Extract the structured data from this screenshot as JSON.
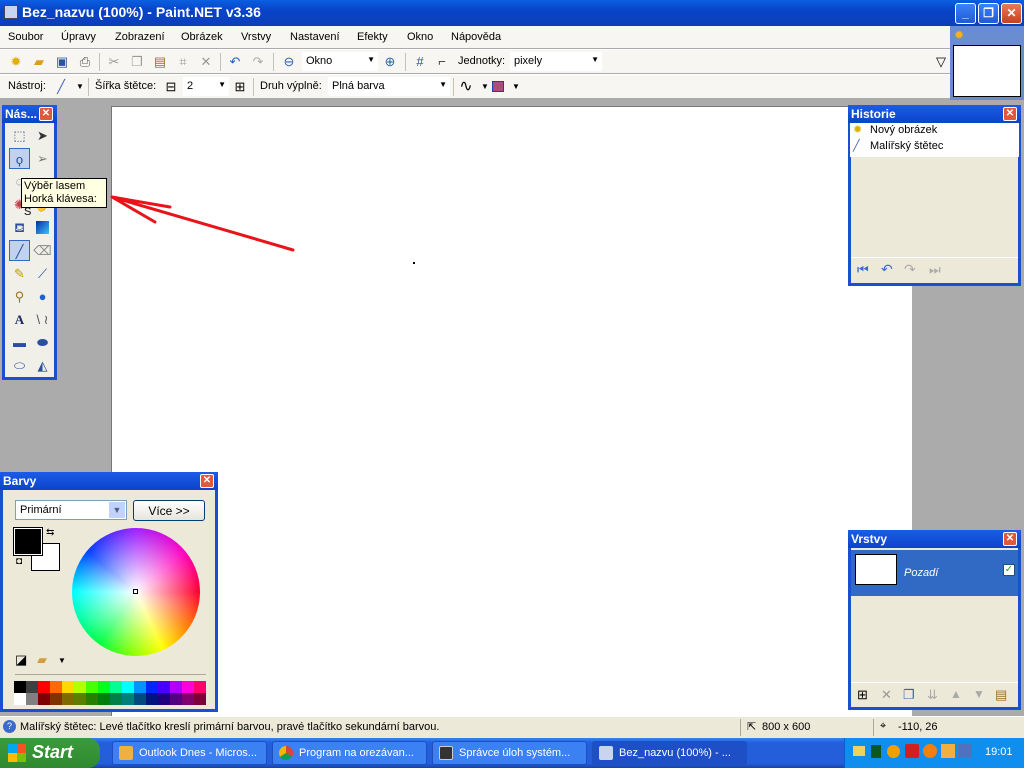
{
  "window": {
    "title": "Bez_nazvu (100%) - Paint.NET v3.36",
    "minimize": "_",
    "restore": "❐",
    "close": "✕"
  },
  "menu": [
    "Soubor",
    "Úpravy",
    "Zobrazení",
    "Obrázek",
    "Vrstvy",
    "Nastavení",
    "Efekty",
    "Okno",
    "Nápověda"
  ],
  "toolbar": {
    "zoom_value": "Okno",
    "units_label": "Jednotky:",
    "units_value": "pixely"
  },
  "toolbar2": {
    "tool_label": "Nástroj:",
    "brush_width_label": "Šířka štětce:",
    "brush_width_value": "2",
    "minus": "⊟",
    "plus": "⊞",
    "fill_label": "Druh výplně:",
    "fill_value": "Plná barva"
  },
  "tools_panel": {
    "title": "Nás...",
    "tooltip_line1": "Výběr lasem",
    "tooltip_line2": "Horká klávesa: S"
  },
  "history": {
    "title": "Historie",
    "items": [
      {
        "label": "Nový obrázek"
      },
      {
        "label": "Malířský štětec"
      }
    ]
  },
  "colors": {
    "title": "Barvy",
    "mode": "Primární",
    "more_button": "Více >>",
    "primary": "#000000",
    "secondary": "#ffffff",
    "palette_top": [
      "#000000",
      "#404040",
      "#ff0000",
      "#ff6a00",
      "#ffd800",
      "#b6ff00",
      "#4cff00",
      "#00ff21",
      "#00ff90",
      "#00ffff",
      "#0094ff",
      "#0026ff",
      "#4800ff",
      "#b200ff",
      "#ff00dc",
      "#ff006e"
    ],
    "palette_bottom": [
      "#ffffff",
      "#808080",
      "#7f0000",
      "#7f3300",
      "#7f6a00",
      "#5b7f00",
      "#267f00",
      "#007f0e",
      "#007f46",
      "#007f7f",
      "#004a7f",
      "#00137f",
      "#21007f",
      "#57007f",
      "#7f006e",
      "#7f0037"
    ]
  },
  "layers": {
    "title": "Vrstvy",
    "layer_name": "Pozadí",
    "visible": true
  },
  "status": {
    "message": "Malířský štětec: Levé tlačítko kreslí primární barvou, pravé tlačítko sekundární barvou.",
    "image_size": "800 x 600",
    "cursor_pos": "-110, 26"
  },
  "taskbar": {
    "start": "Start",
    "tasks": [
      "Outlook Dnes - Micros...",
      "Program na orezávan...",
      "Správce úloh systém...",
      "Bez_nazvu (100%) - ..."
    ],
    "clock": "19:01"
  }
}
